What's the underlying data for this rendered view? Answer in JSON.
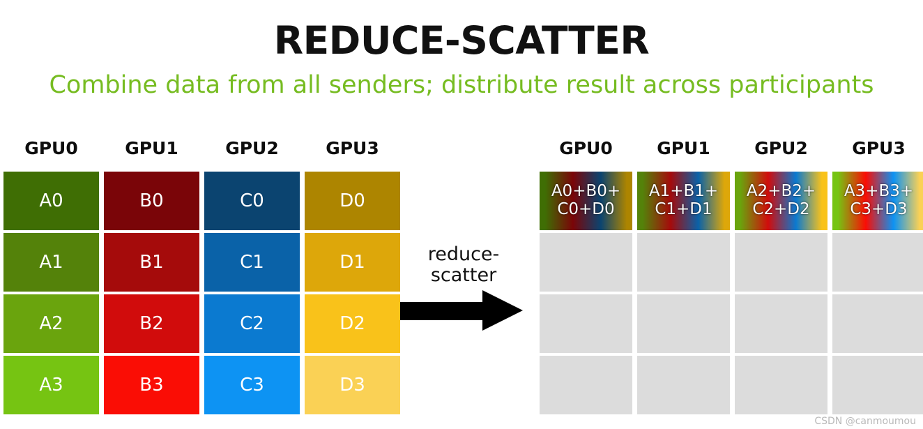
{
  "title": "REDUCE-SCATTER",
  "subtitle": "Combine data from all senders; distribute result across participants",
  "operation": {
    "label": "reduce-\nscatter",
    "arrow_icon": "arrow-right-icon"
  },
  "watermark": "CSDN @canmoumou",
  "colors": {
    "subtitle_green": "#76bc21",
    "title_black": "#111111",
    "empty_cell_gray": "#dcdcdc",
    "arrow_black": "#000000",
    "watermark_gray": "#b9b9b9",
    "gap_white": "#ffffff"
  },
  "source_matrix": {
    "headers": [
      "GPU0",
      "GPU1",
      "GPU2",
      "GPU3"
    ],
    "columns": [
      {
        "header": "GPU0",
        "cells": [
          {
            "label": "A0",
            "color": "#3f6e04"
          },
          {
            "label": "A1",
            "color": "#54820a"
          },
          {
            "label": "A2",
            "color": "#6aa40d"
          },
          {
            "label": "A3",
            "color": "#76c412"
          }
        ]
      },
      {
        "header": "GPU1",
        "cells": [
          {
            "label": "B0",
            "color": "#7a0508"
          },
          {
            "label": "B1",
            "color": "#a50b0b"
          },
          {
            "label": "B2",
            "color": "#d10c0c"
          },
          {
            "label": "B3",
            "color": "#fa0d05"
          }
        ]
      },
      {
        "header": "GPU2",
        "cells": [
          {
            "label": "C0",
            "color": "#0b4470"
          },
          {
            "label": "C1",
            "color": "#0a62a8"
          },
          {
            "label": "C2",
            "color": "#0b7ad0"
          },
          {
            "label": "C3",
            "color": "#0d93f3"
          }
        ]
      },
      {
        "header": "GPU3",
        "cells": [
          {
            "label": "D0",
            "color": "#ad8500"
          },
          {
            "label": "D1",
            "color": "#dda70a"
          },
          {
            "label": "D2",
            "color": "#f9c21a"
          },
          {
            "label": "D3",
            "color": "#fad155"
          }
        ]
      }
    ]
  },
  "result_matrix": {
    "headers": [
      "GPU0",
      "GPU1",
      "GPU2",
      "GPU3"
    ],
    "columns": [
      {
        "header": "GPU0",
        "cells": [
          {
            "label": "A0+B0+\nC0+D0",
            "gradient_stops": [
              "#3f6e04",
              "#7a0508",
              "#0b4470",
              "#ad8500"
            ],
            "empty": false
          },
          {
            "label": "",
            "empty": true
          },
          {
            "label": "",
            "empty": true
          },
          {
            "label": "",
            "empty": true
          }
        ]
      },
      {
        "header": "GPU1",
        "cells": [
          {
            "label": "A1+B1+\nC1+D1",
            "gradient_stops": [
              "#54820a",
              "#a50b0b",
              "#0a62a8",
              "#dda70a"
            ],
            "empty": false
          },
          {
            "label": "",
            "empty": true
          },
          {
            "label": "",
            "empty": true
          },
          {
            "label": "",
            "empty": true
          }
        ]
      },
      {
        "header": "GPU2",
        "cells": [
          {
            "label": "A2+B2+\nC2+D2",
            "gradient_stops": [
              "#6aa40d",
              "#d10c0c",
              "#0b7ad0",
              "#f9c21a"
            ],
            "empty": false
          },
          {
            "label": "",
            "empty": true
          },
          {
            "label": "",
            "empty": true
          },
          {
            "label": "",
            "empty": true
          }
        ]
      },
      {
        "header": "GPU3",
        "cells": [
          {
            "label": "A3+B3+\nC3+D3",
            "gradient_stops": [
              "#76c412",
              "#fa0d05",
              "#0d93f3",
              "#fad155"
            ],
            "empty": false
          },
          {
            "label": "",
            "empty": true
          },
          {
            "label": "",
            "empty": true
          },
          {
            "label": "",
            "empty": true
          }
        ]
      }
    ]
  }
}
